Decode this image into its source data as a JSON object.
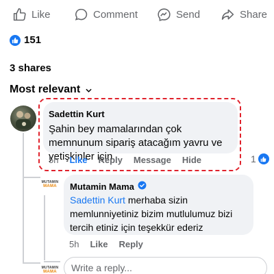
{
  "actions": {
    "like": "Like",
    "comment": "Comment",
    "send": "Send",
    "share": "Share"
  },
  "reactions": {
    "count": "151",
    "icon": "thumbs-up-icon"
  },
  "shares": "3 shares",
  "sort": {
    "label": "Most relevant"
  },
  "comment": {
    "author": "Sadettin Kurt",
    "text": "Şahin bey mamalarından çok memnunum sipariş atacağım yavru ve yetişkinler için",
    "time": "5h",
    "like": "Like",
    "reply": "Reply",
    "message": "Message",
    "hide": "Hide",
    "reaction_count": "1"
  },
  "reply": {
    "author": "Mutamin Mama",
    "mention": "Sadettin Kurt",
    "text": " merhaba sizin memlunniyetiniz bizim mutlulumuz bizi tercih etiniz için teşekkür ederiz",
    "time": "5h",
    "like": "Like",
    "reply": "Reply",
    "verified_icon": "verified-badge-icon"
  },
  "logo": {
    "line1": "MUTAMIN",
    "line2": "MAMA"
  },
  "reply_input": {
    "placeholder": "Write a reply..."
  },
  "colors": {
    "accent": "#1877f2",
    "highlight": "#e0212b",
    "bubble": "#f0f2f5",
    "muted": "#65676b"
  }
}
